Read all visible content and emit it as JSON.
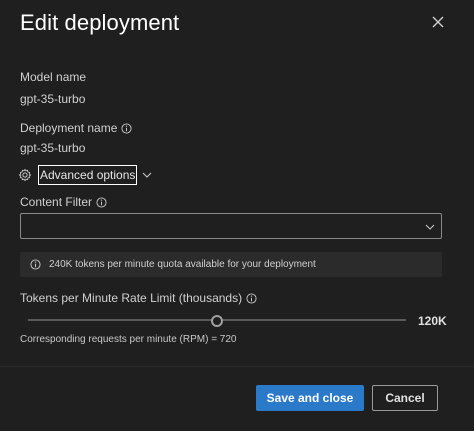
{
  "dialog": {
    "title": "Edit deployment",
    "close_icon": "close-icon"
  },
  "model": {
    "label": "Model name",
    "value": "gpt-35-turbo"
  },
  "deployment": {
    "label": "Deployment name",
    "value": "gpt-35-turbo",
    "info_icon": "info-icon"
  },
  "advanced": {
    "label": "Advanced options",
    "icon": "gear-icon",
    "toggle_icon": "chevron-down-icon"
  },
  "content_filter": {
    "label": "Content Filter",
    "value": "",
    "dropdown_icon": "chevron-down-icon"
  },
  "notice": {
    "text": "240K tokens per minute quota available for your deployment"
  },
  "rate_limit": {
    "label": "Tokens per Minute Rate Limit (thousands)",
    "value_display": "120K",
    "value": 120,
    "max": 240,
    "fraction": 0.5
  },
  "rpm": {
    "text": "Corresponding requests per minute (RPM) = 720"
  },
  "footer": {
    "save_label": "Save and close",
    "cancel_label": "Cancel"
  },
  "colors": {
    "primary": "#2b79c9",
    "background": "#1f1f1f"
  }
}
